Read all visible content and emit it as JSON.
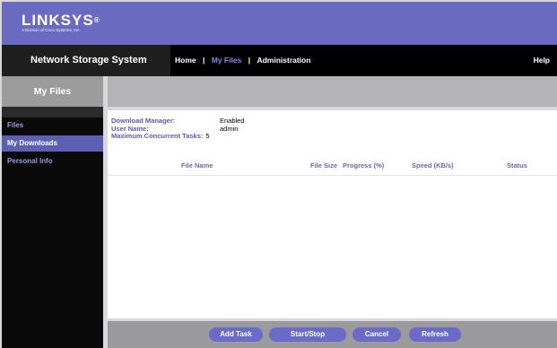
{
  "brand": {
    "logo_text": "LINKSYS",
    "logo_reg": "®",
    "tagline": "A Division of Cisco Systems, Inc."
  },
  "nav": {
    "title": "Network Storage System",
    "links": [
      {
        "label": "Home",
        "active": false
      },
      {
        "label": "My Files",
        "active": true
      },
      {
        "label": "Administration",
        "active": false
      }
    ],
    "separator": "|",
    "help": "Help"
  },
  "sidebar": {
    "header": "My Files",
    "items": [
      {
        "label": "Files",
        "active": false
      },
      {
        "label": "My Downloads",
        "active": true
      },
      {
        "label": "Personal Info",
        "active": false
      }
    ]
  },
  "info": {
    "download_manager_label": "Download Manager:",
    "download_manager_value": "Enabled",
    "user_name_label": "User Name:",
    "user_name_value": "admin",
    "max_tasks_label": "Maximum Concurrent Tasks:",
    "max_tasks_value": "5"
  },
  "table": {
    "columns": [
      "File Name",
      "File Size",
      "Progress (%)",
      "Speed (KB/s)",
      "Status"
    ],
    "rows": []
  },
  "buttons": {
    "add_task": "Add Task",
    "start_stop": "Start/Stop",
    "cancel": "Cancel",
    "refresh": "Refresh"
  },
  "colors": {
    "brand_purple": "#6a6ac0",
    "nav_active": "#7e85ee",
    "sidebar_active": "#5d5fb5",
    "label_purple": "#5a5aa8",
    "button": "#6a6ac8"
  }
}
